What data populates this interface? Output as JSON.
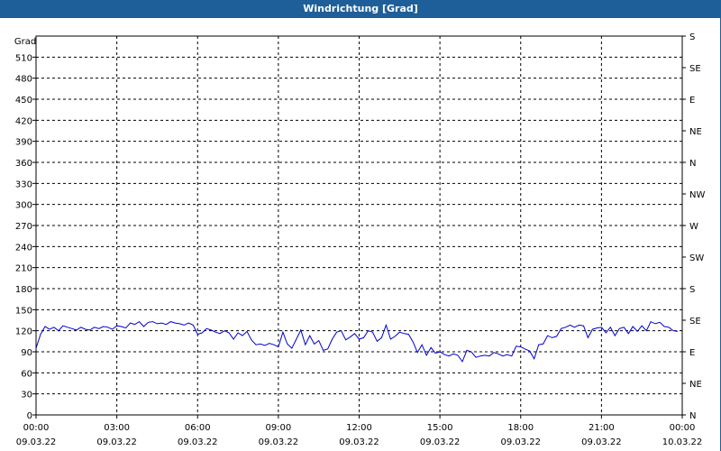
{
  "title": "Windrichtung [Grad]",
  "chart_data": {
    "type": "line",
    "title": "Windrichtung [Grad]",
    "ylabel": "Grad",
    "ylim": [
      0,
      540
    ],
    "y_ticks": [
      0,
      30,
      60,
      90,
      120,
      150,
      180,
      210,
      240,
      270,
      300,
      330,
      360,
      390,
      420,
      450,
      480,
      510
    ],
    "right_ticks": [
      {
        "value": 0,
        "label": "N"
      },
      {
        "value": 45,
        "label": "NE"
      },
      {
        "value": 90,
        "label": "E"
      },
      {
        "value": 135,
        "label": "SE"
      },
      {
        "value": 180,
        "label": "S"
      },
      {
        "value": 225,
        "label": "SW"
      },
      {
        "value": 270,
        "label": "W"
      },
      {
        "value": 315,
        "label": "NW"
      },
      {
        "value": 360,
        "label": "N"
      },
      {
        "value": 405,
        "label": "NE"
      },
      {
        "value": 450,
        "label": "E"
      },
      {
        "value": 495,
        "label": "SE"
      },
      {
        "value": 540,
        "label": "S"
      }
    ],
    "x_range": [
      "09.03.22 00:00",
      "10.03.22 00:00"
    ],
    "x_ticks": [
      {
        "time": "00:00",
        "date": "09.03.22"
      },
      {
        "time": "03:00",
        "date": "09.03.22"
      },
      {
        "time": "06:00",
        "date": "09.03.22"
      },
      {
        "time": "09:00",
        "date": "09.03.22"
      },
      {
        "time": "12:00",
        "date": "09.03.22"
      },
      {
        "time": "15:00",
        "date": "09.03.22"
      },
      {
        "time": "18:00",
        "date": "09.03.22"
      },
      {
        "time": "21:00",
        "date": "09.03.22"
      },
      {
        "time": "00:00",
        "date": "10.03.22"
      }
    ],
    "grid": true,
    "line_color": "#0000cc",
    "series": [
      {
        "x": [
          "00:00",
          "00:10",
          "00:20",
          "00:30",
          "00:40",
          "00:50",
          "01:00",
          "01:10",
          "01:20",
          "01:30",
          "01:40",
          "01:50",
          "02:00",
          "02:10",
          "02:20",
          "02:30",
          "02:40",
          "02:50",
          "03:00",
          "03:10",
          "03:20",
          "03:30",
          "03:40",
          "03:50",
          "04:00",
          "04:10",
          "04:20",
          "04:30",
          "04:40",
          "04:50",
          "05:00",
          "05:10",
          "05:20",
          "05:30",
          "05:40",
          "05:50",
          "06:00",
          "06:10",
          "06:20",
          "06:30",
          "06:40",
          "06:50",
          "07:00",
          "07:10",
          "07:20",
          "07:30",
          "07:40",
          "07:50",
          "08:00",
          "08:10",
          "08:20",
          "08:30",
          "08:40",
          "08:50",
          "09:00",
          "09:10",
          "09:20",
          "09:30",
          "09:40",
          "09:50",
          "10:00",
          "10:10",
          "10:20",
          "10:30",
          "10:40",
          "10:50",
          "11:00",
          "11:10",
          "11:20",
          "11:30",
          "11:40",
          "11:50",
          "12:00",
          "12:10",
          "12:20",
          "12:30",
          "12:40",
          "12:50",
          "13:00",
          "13:10",
          "13:20",
          "13:30",
          "13:40",
          "13:50",
          "14:00",
          "14:10",
          "14:20",
          "14:30",
          "14:40",
          "14:50",
          "15:00",
          "15:10",
          "15:20",
          "15:30",
          "15:40",
          "15:50",
          "16:00",
          "16:10",
          "16:20",
          "16:30",
          "16:40",
          "16:50",
          "17:00",
          "17:10",
          "17:20",
          "17:30",
          "17:40",
          "17:50",
          "18:00",
          "18:10",
          "18:20",
          "18:30",
          "18:40",
          "18:50",
          "19:00",
          "19:10",
          "19:20",
          "19:30",
          "19:40",
          "19:50",
          "20:00",
          "20:10",
          "20:20",
          "20:30",
          "20:40",
          "20:50",
          "21:00",
          "21:10",
          "21:20",
          "21:30",
          "21:40",
          "21:50",
          "22:00",
          "22:10",
          "22:20",
          "22:30",
          "22:40",
          "22:50",
          "23:00",
          "23:10",
          "23:20",
          "23:30",
          "23:40",
          "23:50"
        ],
        "values": [
          95,
          115,
          126,
          122,
          125,
          120,
          127,
          125,
          123,
          121,
          125,
          122,
          121,
          125,
          123,
          126,
          125,
          122,
          127,
          126,
          124,
          131,
          129,
          133,
          126,
          132,
          133,
          130,
          131,
          129,
          133,
          131,
          130,
          128,
          131,
          128,
          115,
          117,
          123,
          121,
          118,
          116,
          120,
          117,
          108,
          117,
          113,
          119,
          107,
          100,
          101,
          99,
          102,
          100,
          97,
          118,
          101,
          95,
          108,
          121,
          100,
          113,
          101,
          106,
          92,
          94,
          108,
          118,
          120,
          107,
          111,
          116,
          108,
          110,
          120,
          118,
          105,
          110,
          128,
          108,
          112,
          118,
          116,
          115,
          104,
          89,
          100,
          85,
          96,
          88,
          90,
          86,
          84,
          87,
          85,
          76,
          92,
          90,
          82,
          84,
          85,
          84,
          89,
          87,
          84,
          86,
          84,
          98,
          97,
          94,
          91,
          80,
          100,
          101,
          113,
          110,
          112,
          123,
          125,
          128,
          125,
          128,
          127,
          110,
          122,
          124,
          125,
          117,
          125,
          113,
          123,
          125,
          116,
          126,
          119,
          127,
          120,
          133,
          130,
          132,
          126,
          125,
          120,
          119
        ]
      }
    ]
  }
}
